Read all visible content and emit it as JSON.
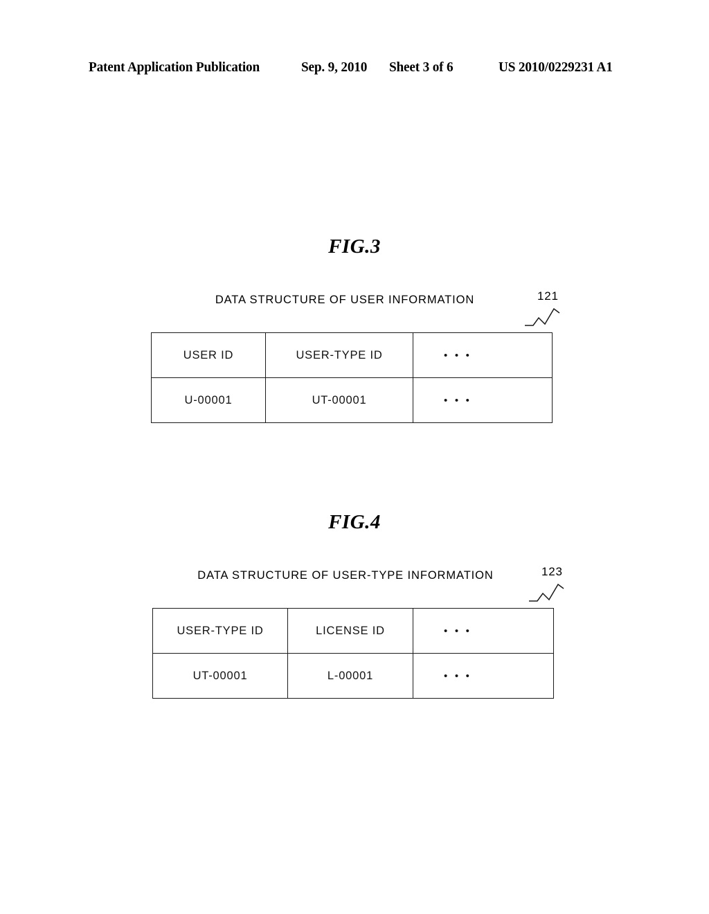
{
  "header": {
    "publication": "Patent Application Publication",
    "date": "Sep. 9, 2010",
    "sheet": "Sheet 3 of 6",
    "patent_number": "US 2010/0229231 A1"
  },
  "figures": [
    {
      "label": "FIG.3",
      "caption": "DATA STRUCTURE OF USER INFORMATION",
      "reference_numeral": "121",
      "table": {
        "headers": [
          "USER ID",
          "USER-TYPE ID",
          "• • •"
        ],
        "rows": [
          [
            "U-00001",
            "UT-00001",
            "• • •"
          ]
        ]
      }
    },
    {
      "label": "FIG.4",
      "caption": "DATA STRUCTURE OF USER-TYPE INFORMATION",
      "reference_numeral": "123",
      "table": {
        "headers": [
          "USER-TYPE ID",
          "LICENSE ID",
          "• • •"
        ],
        "rows": [
          [
            "UT-00001",
            "L-00001",
            "• • •"
          ]
        ]
      }
    }
  ]
}
